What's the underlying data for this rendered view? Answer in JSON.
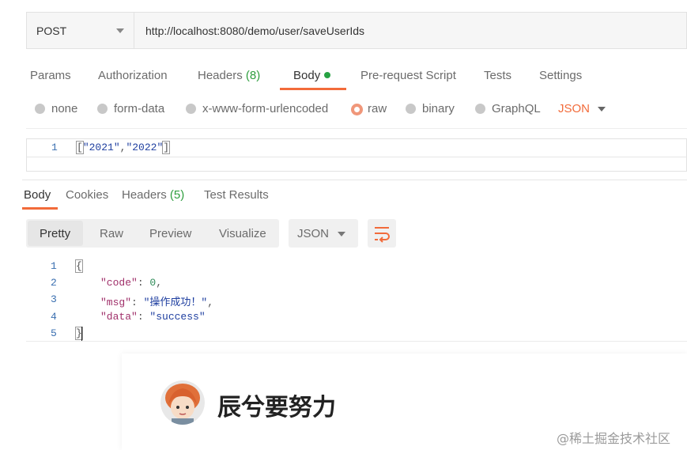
{
  "request": {
    "method": "POST",
    "url": "http://localhost:8080/demo/user/saveUserIds"
  },
  "request_tabs": {
    "params": "Params",
    "authorization": "Authorization",
    "headers": "Headers",
    "headers_count": "(8)",
    "body": "Body",
    "prerequest": "Pre-request Script",
    "tests": "Tests",
    "settings": "Settings"
  },
  "body_types": {
    "none": "none",
    "form_data": "form-data",
    "urlencoded": "x-www-form-urlencoded",
    "raw": "raw",
    "binary": "binary",
    "graphql": "GraphQL",
    "selected": "raw",
    "format": "JSON"
  },
  "request_body": {
    "line_number": "1",
    "open_bracket": "[",
    "value1": "\"2021\"",
    "comma": ",",
    "value2": "\"2022\"",
    "close_bracket": "]"
  },
  "response_tabs": {
    "body": "Body",
    "cookies": "Cookies",
    "headers": "Headers",
    "headers_count": "(5)",
    "test_results": "Test Results"
  },
  "response_view": {
    "pretty": "Pretty",
    "raw": "Raw",
    "preview": "Preview",
    "visualize": "Visualize",
    "format": "JSON"
  },
  "response_body": {
    "line_numbers": [
      "1",
      "2",
      "3",
      "4",
      "5"
    ],
    "open": "{",
    "code_key": "\"code\"",
    "code_value": "0",
    "msg_key": "\"msg\"",
    "msg_value": "\"操作成功！\"",
    "data_key": "\"data\"",
    "data_value": "\"success\"",
    "close": "}"
  },
  "watermark": {
    "author": "辰兮要努力",
    "credit": "@稀土掘金技术社区"
  },
  "colors": {
    "accent": "#f26b3a",
    "count_green": "#2e9e3e",
    "status_dot": "#27a243"
  }
}
